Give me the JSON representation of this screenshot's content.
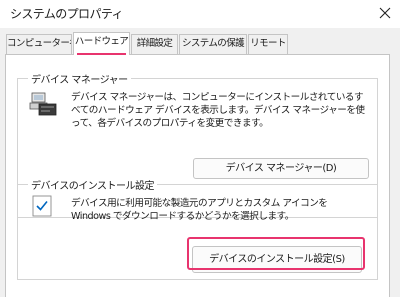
{
  "window": {
    "title": "システムのプロパティ",
    "close_icon": "close-icon"
  },
  "tabs": [
    {
      "label": "コンピューター名",
      "active": false
    },
    {
      "label": "ハードウェア",
      "active": true
    },
    {
      "label": "詳細設定",
      "active": false
    },
    {
      "label": "システムの保護",
      "active": false
    },
    {
      "label": "リモート",
      "active": false
    }
  ],
  "device_manager": {
    "heading": "デバイス マネージャー",
    "icon": "device-manager-icon",
    "description": "デバイス マネージャーは、コンピューターにインストールされているすべてのハードウェア デバイスを表示します。デバイス マネージャーを使って、各デバイスのプロパティを変更できます。",
    "button_label": "デバイス マネージャー(D)"
  },
  "install_settings": {
    "heading": "デバイスのインストール設定",
    "icon": "checklist-icon",
    "description": "デバイス用に利用可能な製造元のアプリとカスタム アイコンを Windows でダウンロードするかどうかを選択します。",
    "button_label": "デバイスのインストール設定(S)"
  },
  "colors": {
    "accent_highlight": "#e8346e",
    "checkmark": "#0067c0"
  }
}
